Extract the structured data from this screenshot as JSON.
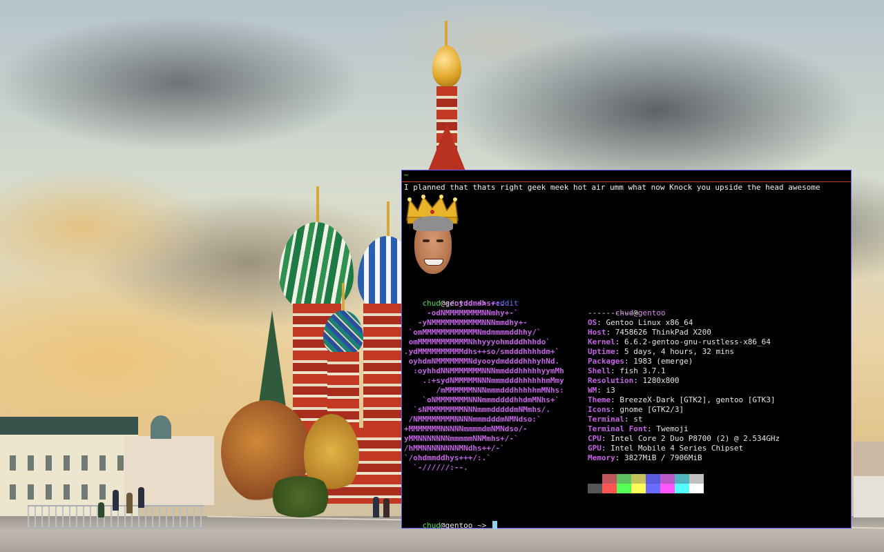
{
  "terminal": {
    "tab_title": "~",
    "message": "I planned that thats right geek meek hot air umm what now Knock you upside the head awesome",
    "prompt1": {
      "user": "chud",
      "at": "@",
      "host": "gentoo",
      "arrow": " ~> ",
      "command": "reddit"
    },
    "prompt2": {
      "user": "chud",
      "at": "@",
      "host": "gentoo",
      "arrow": " ~> "
    },
    "logo_lines": [
      "         -/oyddmdhs+:.",
      "     -odNMMMMMMMMNNmhy+-`",
      "   -yNMMMMMMMMMMMNNNmmdhy+-",
      " `omMMMMMMMMMMMMNmdmmmmddhhy/`",
      " omMMMMMMMMMMMNhhyyyohmdddhhhdo`",
      ".ydMMMMMMMMMMdhs++so/smdddhhhhdm+`",
      " oyhdmNMMMMMMMNdyooydmddddhhhyhNd.",
      "  :oyhhdNNMMMMMMMNNNmmdddhhhhhyymMh",
      "    .:+sydNMMMMMNNNmmmdddhhhhhhmMmy",
      "       /mMMMMMMNNNmmmdddhhhhhmMNhs:",
      "    `oNMMMMMMMNNNmmmddddhhdmMNhs+`",
      "  `sNMMMMMMMMNNNmmmdddddmNMmhs/.",
      " /NMMMMMMMMNNNNmmmdddmNMNdso:`",
      "+MMMMMMMNNNNNmmmmdmNMNdso/-",
      "yMMNNNNNNNmmmmmNNMmhs+/-`",
      "/hMMNNNNNNNNMNdhs++/-`",
      "`/ohdmmddhys+++/:.`",
      "  `-//////:--."
    ],
    "info_user": "chud",
    "info_at": "@",
    "info_host": "gentoo",
    "info_separator": "-----------",
    "info": [
      {
        "key": "OS",
        "value": "Gentoo Linux x86_64"
      },
      {
        "key": "Host",
        "value": "7458626 ThinkPad X200"
      },
      {
        "key": "Kernel",
        "value": "6.6.2-gentoo-gnu-rustless-x86_64"
      },
      {
        "key": "Uptime",
        "value": "5 days, 4 hours, 32 mins"
      },
      {
        "key": "Packages",
        "value": "1983 (emerge)"
      },
      {
        "key": "Shell",
        "value": "fish 3.7.1"
      },
      {
        "key": "Resolution",
        "value": "1280x800"
      },
      {
        "key": "WM",
        "value": "i3"
      },
      {
        "key": "Theme",
        "value": "BreezeX-Dark [GTK2], gentoo [GTK3]"
      },
      {
        "key": "Icons",
        "value": "gnome [GTK2/3]"
      },
      {
        "key": "Terminal",
        "value": "st"
      },
      {
        "key": "Terminal Font",
        "value": "Twemoji"
      },
      {
        "key": "CPU",
        "value": "Intel Core 2 Duo P8700 (2) @ 2.534GHz"
      },
      {
        "key": "GPU",
        "value": "Intel Mobile 4 Series Chipset"
      },
      {
        "key": "Memory",
        "value": "3827MiB / 7906MiB"
      }
    ],
    "palette_top": [
      "#000000",
      "#c0565a",
      "#5ec05e",
      "#c4c25a",
      "#5a5adf",
      "#b958c8",
      "#4fb6c0",
      "#c0c0c0"
    ],
    "palette_bottom": [
      "#555555",
      "#ff5555",
      "#55ff55",
      "#ffff55",
      "#6b6bff",
      "#ff55ff",
      "#55ffff",
      "#ffffff"
    ],
    "colors": {
      "border": "#5a5cf0",
      "accent_green": "#4be24b",
      "accent_purple": "#c662e6",
      "command_blue": "#6b73ff"
    }
  }
}
